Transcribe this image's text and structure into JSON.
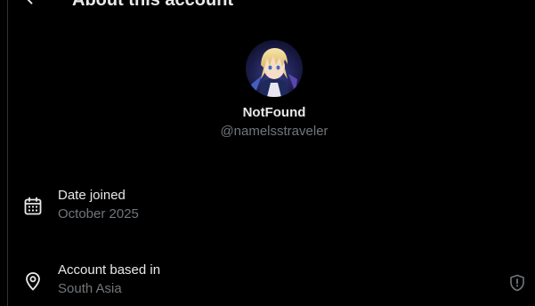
{
  "header": {
    "title": "About this account",
    "back_icon": "back-arrow-icon"
  },
  "profile": {
    "display_name": "NotFound",
    "handle": "@namelsstraveler"
  },
  "details": [
    {
      "icon": "calendar-icon",
      "label": "Date joined",
      "value": "October 2025"
    },
    {
      "icon": "location-pin-icon",
      "label": "Account based in",
      "value": "South Asia",
      "action_icon": "shield-icon"
    }
  ],
  "colors": {
    "background": "#000000",
    "primary_text": "#e7e9ea",
    "secondary_text": "#71767b",
    "border": "#2f3336"
  }
}
